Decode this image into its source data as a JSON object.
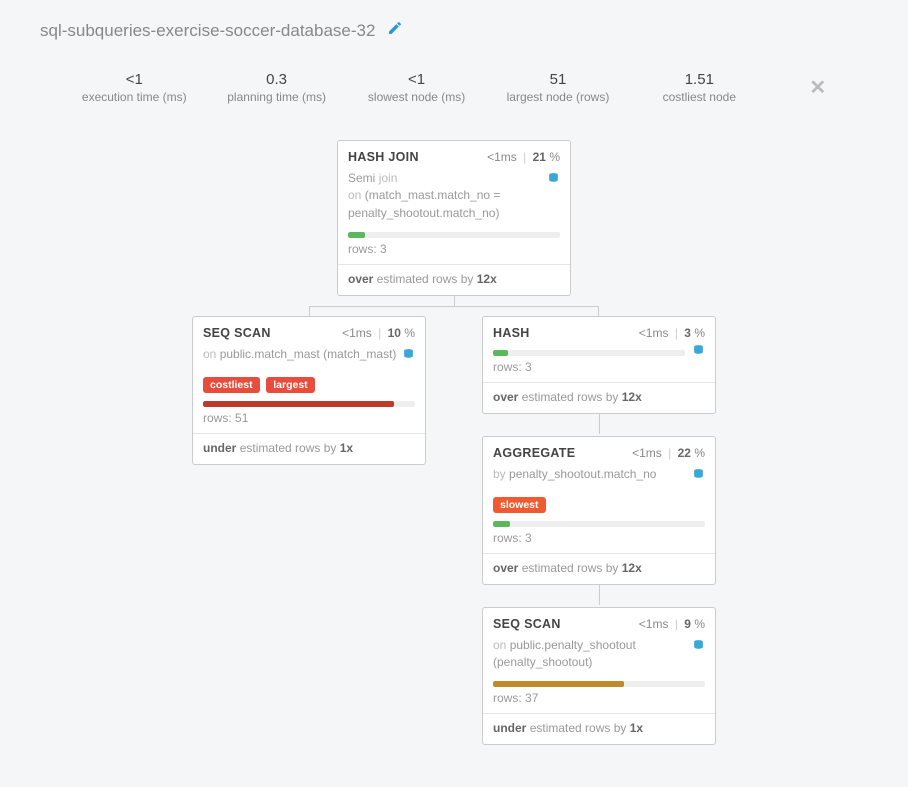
{
  "header": {
    "title": "sql-subqueries-exercise-soccer-database-32"
  },
  "stats": {
    "exec_value": "<1",
    "exec_label": "execution time (ms)",
    "plan_value": "0.3",
    "plan_label": "planning time (ms)",
    "slowest_value": "<1",
    "slowest_label": "slowest node (ms)",
    "largest_value": "51",
    "largest_label": "largest node (rows)",
    "cost_value": "1.51",
    "cost_label": "costliest node"
  },
  "nodes": {
    "hashjoin": {
      "title": "HASH JOIN",
      "time": "<1ms",
      "pct": "21",
      "line1_a": "Semi",
      "line1_b": "join",
      "line2_a": "on",
      "line2_b": "(match_mast.match_no = penalty_shootout.match_no)",
      "bar_pct": 8,
      "bar_color": "bar-green",
      "rows": "3",
      "footer_word": "over",
      "footer_mult": "12"
    },
    "seqscan1": {
      "title": "SEQ SCAN",
      "time": "<1ms",
      "pct": "10",
      "line_a": "on",
      "line_b": "public.match_mast (match_mast)",
      "tag1": "costliest",
      "tag2": "largest",
      "bar_pct": 90,
      "bar_color": "bar-red",
      "rows": "51",
      "footer_word": "under",
      "footer_mult": "1"
    },
    "hash": {
      "title": "HASH",
      "time": "<1ms",
      "pct": "3",
      "bar_pct": 8,
      "bar_color": "bar-green",
      "rows": "3",
      "footer_word": "over",
      "footer_mult": "12"
    },
    "aggregate": {
      "title": "AGGREGATE",
      "time": "<1ms",
      "pct": "22",
      "line_a": "by",
      "line_b": "penalty_shootout.match_no",
      "tag1": "slowest",
      "bar_pct": 8,
      "bar_color": "bar-green",
      "rows": "3",
      "footer_word": "over",
      "footer_mult": "12"
    },
    "seqscan2": {
      "title": "SEQ SCAN",
      "time": "<1ms",
      "pct": "9",
      "line_a": "on",
      "line_b": "public.penalty_shootout (penalty_shootout)",
      "bar_pct": 62,
      "bar_color": "bar-gold",
      "rows": "37",
      "footer_word": "under",
      "footer_mult": "1"
    }
  },
  "labels": {
    "rows": "rows:",
    "estimated": "estimated rows by",
    "x": "x",
    "pct": "%"
  }
}
